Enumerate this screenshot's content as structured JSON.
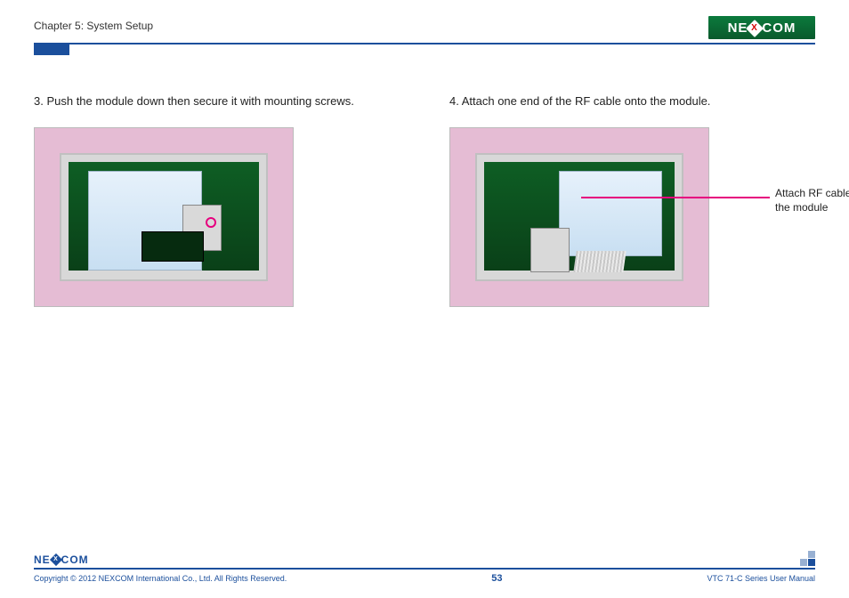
{
  "header": {
    "chapter": "Chapter 5: System Setup",
    "logo_text_a": "NE",
    "logo_text_x": "X",
    "logo_text_b": "COM"
  },
  "steps": {
    "left": "3. Push the module down then secure it with mounting screws.",
    "right": "4. Attach one end of the RF cable onto the module."
  },
  "annotations": {
    "rf_cable": "Attach RF cable to the module"
  },
  "footer": {
    "logo_text_a": "NE",
    "logo_text_x": "X",
    "logo_text_b": "COM",
    "copyright": "Copyright © 2012 NEXCOM International Co., Ltd. All Rights Reserved.",
    "page_number": "53",
    "doc_title": "VTC 71-C Series User Manual"
  }
}
